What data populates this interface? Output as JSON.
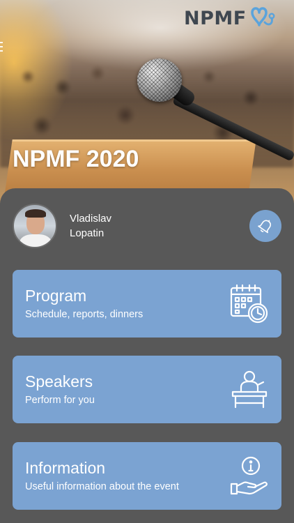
{
  "brand": {
    "logo_text": "NPMF",
    "accent_color": "#7ba3d2",
    "panel_color": "#585858"
  },
  "hero": {
    "title": "NPMF 2020"
  },
  "profile": {
    "first_name": "Vladislav",
    "last_name": "Lopatin"
  },
  "cards": [
    {
      "title": "Program",
      "subtitle": "Schedule, reports, dinners",
      "icon": "calendar-clock-icon"
    },
    {
      "title": "Speakers",
      "subtitle": "Perform for you",
      "icon": "speaker-podium-icon"
    },
    {
      "title": "Information",
      "subtitle": "Useful information about the event",
      "icon": "info-hand-icon"
    }
  ],
  "icons": {
    "notification": "bell-icon",
    "menu": "menu-icon",
    "logo_mark": "heart-stethoscope-icon"
  }
}
